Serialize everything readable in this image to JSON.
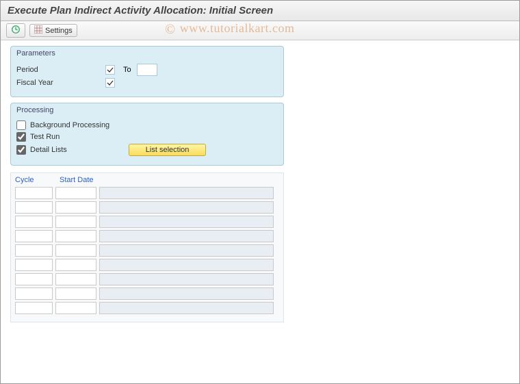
{
  "title": "Execute Plan Indirect Activity Allocation: Initial Screen",
  "watermark": "www.tutorialkart.com",
  "toolbar": {
    "settings_label": "Settings"
  },
  "parameters": {
    "group_title": "Parameters",
    "period_label": "Period",
    "to_label": "To",
    "fiscal_year_label": "Fiscal Year",
    "period_from": "",
    "period_to": "",
    "fiscal_year": ""
  },
  "processing": {
    "group_title": "Processing",
    "background_label": "Background Processing",
    "testrun_label": "Test Run",
    "detail_label": "Detail Lists",
    "background_checked": false,
    "testrun_checked": true,
    "detail_checked": true,
    "list_selection_label": "List selection"
  },
  "table": {
    "cycle_header": "Cycle",
    "startdate_header": "Start Date",
    "rows": [
      {
        "cycle": "",
        "date": "",
        "desc": ""
      },
      {
        "cycle": "",
        "date": "",
        "desc": ""
      },
      {
        "cycle": "",
        "date": "",
        "desc": ""
      },
      {
        "cycle": "",
        "date": "",
        "desc": ""
      },
      {
        "cycle": "",
        "date": "",
        "desc": ""
      },
      {
        "cycle": "",
        "date": "",
        "desc": ""
      },
      {
        "cycle": "",
        "date": "",
        "desc": ""
      },
      {
        "cycle": "",
        "date": "",
        "desc": ""
      },
      {
        "cycle": "",
        "date": "",
        "desc": ""
      }
    ]
  }
}
